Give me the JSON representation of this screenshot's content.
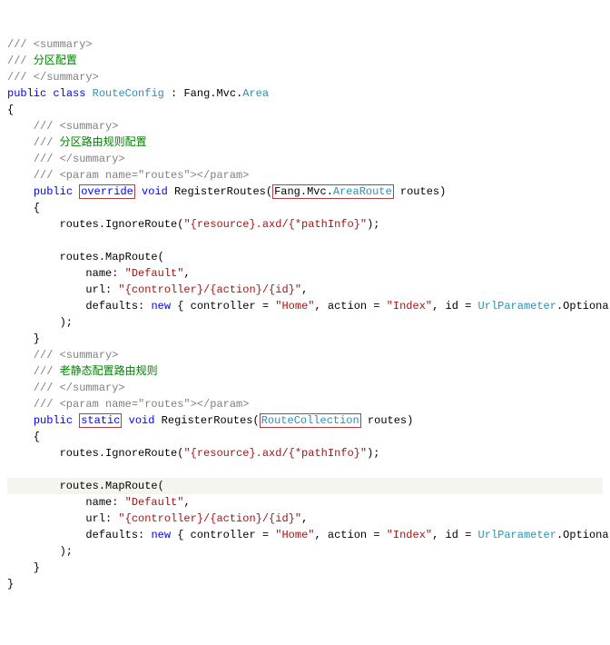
{
  "lines": {
    "l01_a": "/// <summary>",
    "l02_a": "/// ",
    "l02_b": "分区配置",
    "l03_a": "/// </summary>",
    "l04_a": "public",
    "l04_b": " ",
    "l04_c": "class",
    "l04_d": " ",
    "l04_e": "RouteConfig",
    "l04_f": " : Fang.Mvc.",
    "l04_g": "Area",
    "l05_a": "{",
    "l06_a": "    /// <summary>",
    "l07_a": "    /// ",
    "l07_b": "分区路由规则配置",
    "l08_a": "    /// </summary>",
    "l09_a": "    /// <param name=\"routes\"></param>",
    "l10_a": "    ",
    "l10_b": "public",
    "l10_c": " ",
    "l10_d": "override",
    "l10_e": " ",
    "l10_f": "void",
    "l10_g": " RegisterRoutes(",
    "l10_h": "Fang.Mvc.",
    "l10_i": "AreaRoute",
    "l10_j": " routes)",
    "l11_a": "    {",
    "l12_a": "        routes.IgnoreRoute(",
    "l12_b": "\"{resource}.axd/{*pathInfo}\"",
    "l12_c": ");",
    "l13_a": "",
    "l14_a": "        routes.MapRoute(",
    "l15_a": "            name: ",
    "l15_b": "\"Default\"",
    "l15_c": ",",
    "l16_a": "            url: ",
    "l16_b": "\"{controller}/{action}/{id}\"",
    "l16_c": ",",
    "l17_a": "            defaults: ",
    "l17_b": "new",
    "l17_c": " { controller = ",
    "l17_d": "\"Home\"",
    "l17_e": ", action = ",
    "l17_f": "\"Index\"",
    "l17_g": ", id = ",
    "l17_h": "UrlParameter",
    "l17_i": ".Optional }",
    "l18_a": "        );",
    "l19_a": "    }",
    "l20_a": "    /// <summary>",
    "l21_a": "    /// ",
    "l21_b": "老静态配置路由规则",
    "l22_a": "    /// </summary>",
    "l23_a": "    /// <param name=\"routes\"></param>",
    "l24_a": "    ",
    "l24_b": "public",
    "l24_c": " ",
    "l24_d": "static",
    "l24_e": " ",
    "l24_f": "void",
    "l24_g": " RegisterRoutes(",
    "l24_h": "RouteCollection",
    "l24_i": " routes)",
    "l25_a": "    {",
    "l26_a": "        routes.IgnoreRoute(",
    "l26_b": "\"{resource}.axd/{*pathInfo}\"",
    "l26_c": ");",
    "l27_a": "",
    "l28_a": "        routes.MapRoute(",
    "l29_a": "            name: ",
    "l29_b": "\"Default\"",
    "l29_c": ",",
    "l30_a": "            url: ",
    "l30_b": "\"{controller}/{action}/{id}\"",
    "l30_c": ",",
    "l31_a": "            defaults: ",
    "l31_b": "new",
    "l31_c": " { controller = ",
    "l31_d": "\"Home\"",
    "l31_e": ", action = ",
    "l31_f": "\"Index\"",
    "l31_g": ", id = ",
    "l31_h": "UrlParameter",
    "l31_i": ".Optional }",
    "l32_a": "        );",
    "l33_a": "    }",
    "l34_a": "}"
  }
}
